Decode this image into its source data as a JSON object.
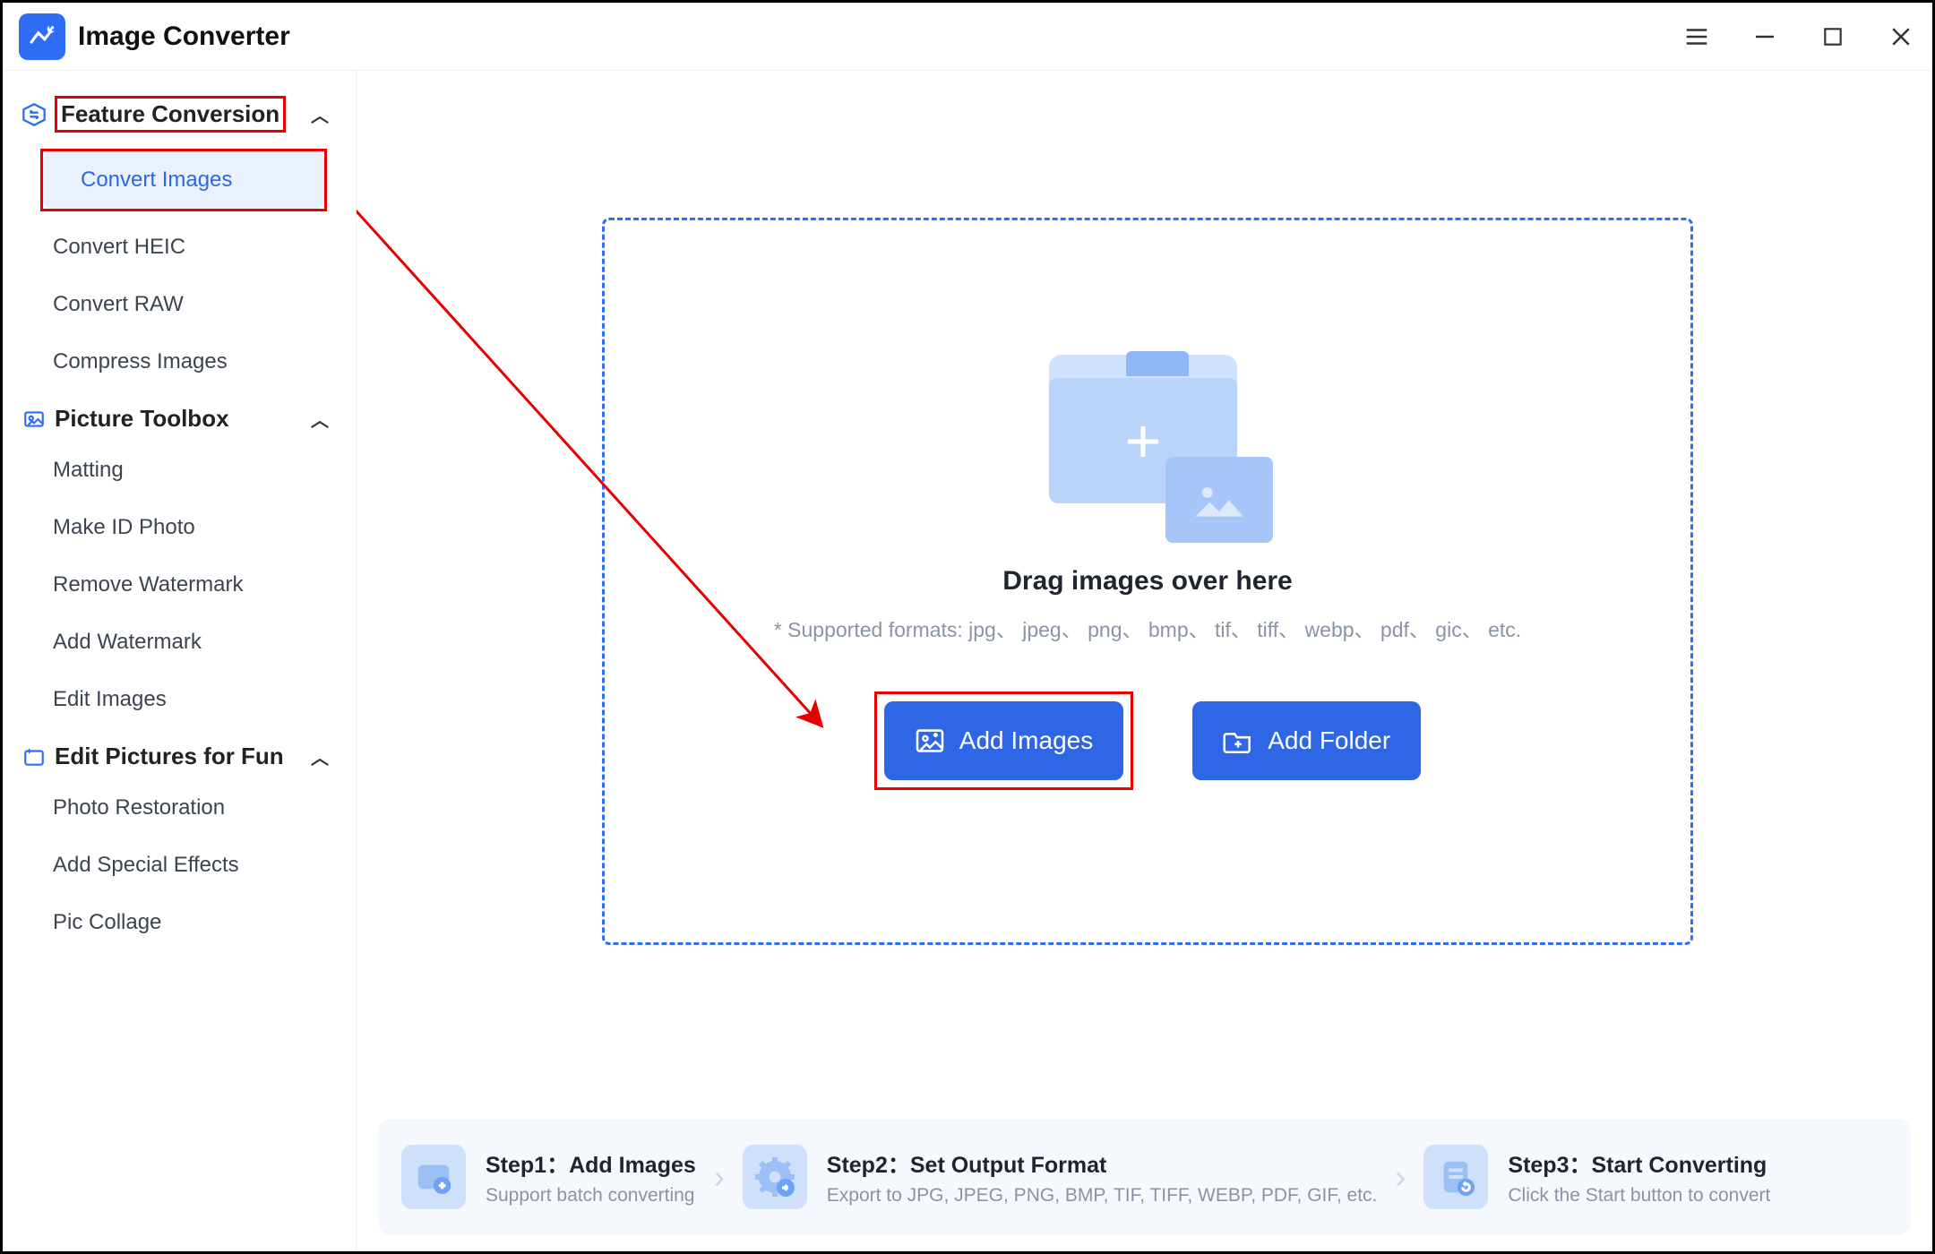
{
  "app": {
    "title": "Image Converter"
  },
  "sidebar": {
    "groups": [
      {
        "label": "Feature Conversion",
        "items": [
          {
            "label": "Convert Images"
          },
          {
            "label": "Convert HEIC"
          },
          {
            "label": "Convert RAW"
          },
          {
            "label": "Compress Images"
          }
        ]
      },
      {
        "label": "Picture Toolbox",
        "items": [
          {
            "label": "Matting"
          },
          {
            "label": "Make ID Photo"
          },
          {
            "label": "Remove Watermark"
          },
          {
            "label": "Add Watermark"
          },
          {
            "label": "Edit Images"
          }
        ]
      },
      {
        "label": "Edit Pictures for Fun",
        "items": [
          {
            "label": "Photo Restoration"
          },
          {
            "label": "Add Special Effects"
          },
          {
            "label": "Pic Collage"
          }
        ]
      }
    ]
  },
  "dropzone": {
    "title": "Drag images over here",
    "subtitle": "* Supported formats: jpg、 jpeg、 png、 bmp、 tif、 tiff、 webp、 pdf、 gic、 etc.",
    "add_images": "Add Images",
    "add_folder": "Add Folder"
  },
  "steps": {
    "s1_head": "Step1：Add Images",
    "s1_sub": "Support batch converting",
    "s2_head": "Step2：Set Output Format",
    "s2_sub": "Export to JPG, JPEG, PNG, BMP, TIF, TIFF, WEBP, PDF, GIF, etc.",
    "s3_head": "Step3：Start Converting",
    "s3_sub": "Click the Start button to convert"
  }
}
